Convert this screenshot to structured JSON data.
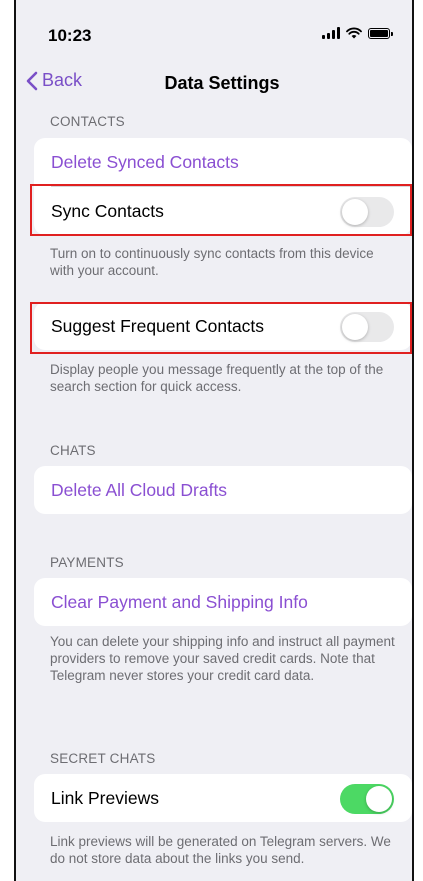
{
  "status_bar": {
    "time": "10:23"
  },
  "nav": {
    "back_label": "Back",
    "title": "Data Settings"
  },
  "sections": {
    "contacts": {
      "header": "CONTACTS",
      "delete_synced": "Delete Synced Contacts",
      "sync_contacts": {
        "label": "Sync Contacts",
        "enabled": false
      },
      "sync_footer": "Turn on to continuously sync contacts from this device with your account.",
      "suggest_frequent": {
        "label": "Suggest Frequent Contacts",
        "enabled": false
      },
      "suggest_footer": "Display people you message frequently at the top of the search section for quick access."
    },
    "chats": {
      "header": "CHATS",
      "delete_drafts": "Delete All Cloud Drafts"
    },
    "payments": {
      "header": "PAYMENTS",
      "clear_info": "Clear Payment and Shipping Info",
      "footer": "You can delete your shipping info and instruct all payment providers to remove your saved credit cards. Note that Telegram never stores your credit card data."
    },
    "secret_chats": {
      "header": "SECRET CHATS",
      "link_previews": {
        "label": "Link Previews",
        "enabled": true
      },
      "footer": "Link previews will be generated on Telegram servers. We do not store data about the links you send."
    }
  },
  "colors": {
    "accent": "#8a4fd2",
    "toggle_on": "#4cd964",
    "toggle_off": "#e9e9ea",
    "highlight": "#e02020",
    "background": "#efeff4"
  }
}
